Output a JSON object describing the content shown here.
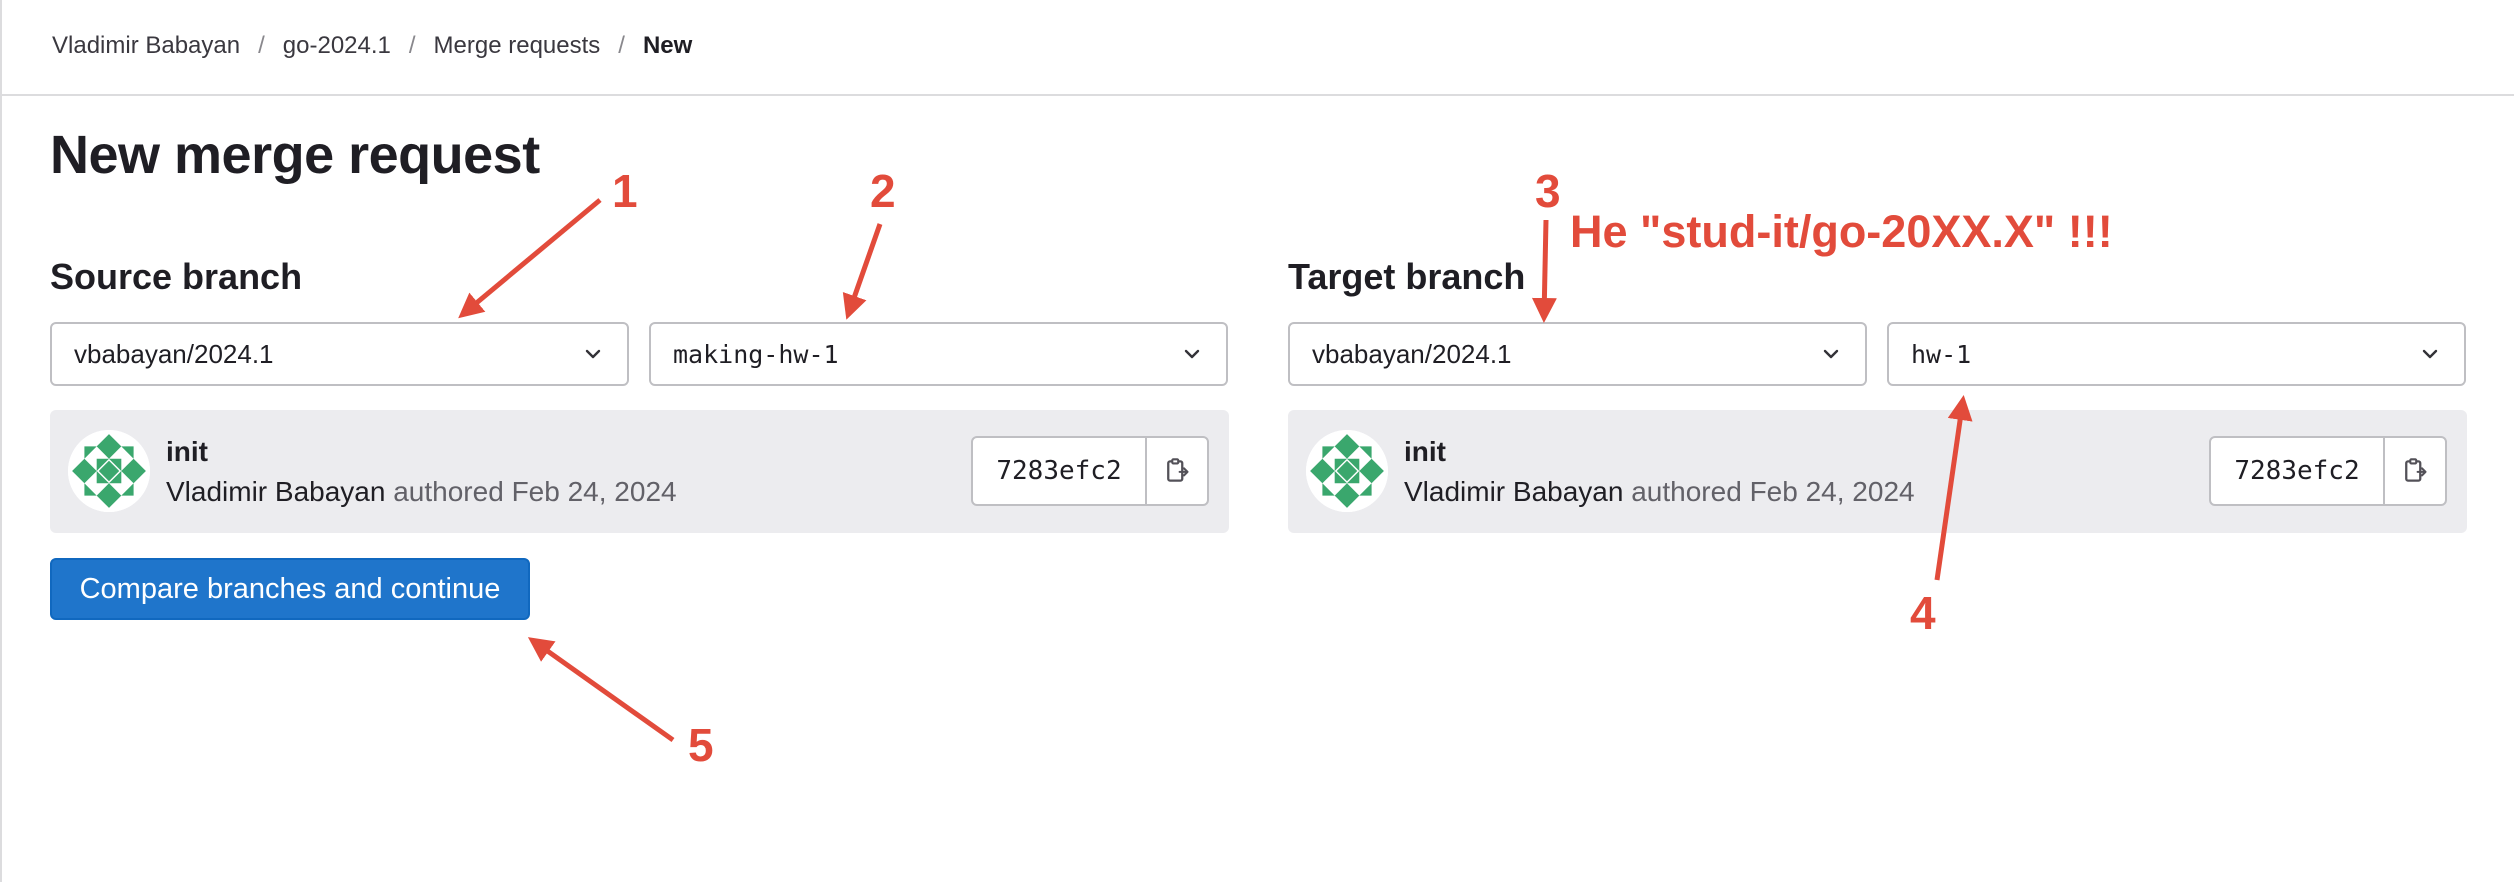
{
  "breadcrumb": {
    "items": [
      "Vladimir Babayan",
      "go-2024.1",
      "Merge requests"
    ],
    "current": "New",
    "separator": "/"
  },
  "page": {
    "title": "New merge request"
  },
  "source": {
    "label": "Source branch",
    "project": "vbabayan/2024.1",
    "branch": "making-hw-1",
    "commit": {
      "title": "init",
      "author": "Vladimir Babayan",
      "verb": "authored",
      "date": "Feb 24, 2024",
      "sha": "7283efc2"
    }
  },
  "target": {
    "label": "Target branch",
    "project": "vbabayan/2024.1",
    "branch": "hw-1",
    "commit": {
      "title": "init",
      "author": "Vladimir Babayan",
      "verb": "authored",
      "date": "Feb 24, 2024",
      "sha": "7283efc2"
    }
  },
  "actions": {
    "compare": "Compare branches and continue"
  },
  "annotations": {
    "n1": "1",
    "n2": "2",
    "n3": "3",
    "n4": "4",
    "n5": "5",
    "note": "Не \"stud-it/go-20XX.X\" !!!"
  },
  "colors": {
    "accent": "#1f75cb",
    "annotation": "#e24b3b",
    "card": "#ececef",
    "avatar_green": "#3aa76d"
  },
  "icons": [
    "chevron-down-icon",
    "copy-to-clipboard-icon",
    "identicon-avatar"
  ]
}
